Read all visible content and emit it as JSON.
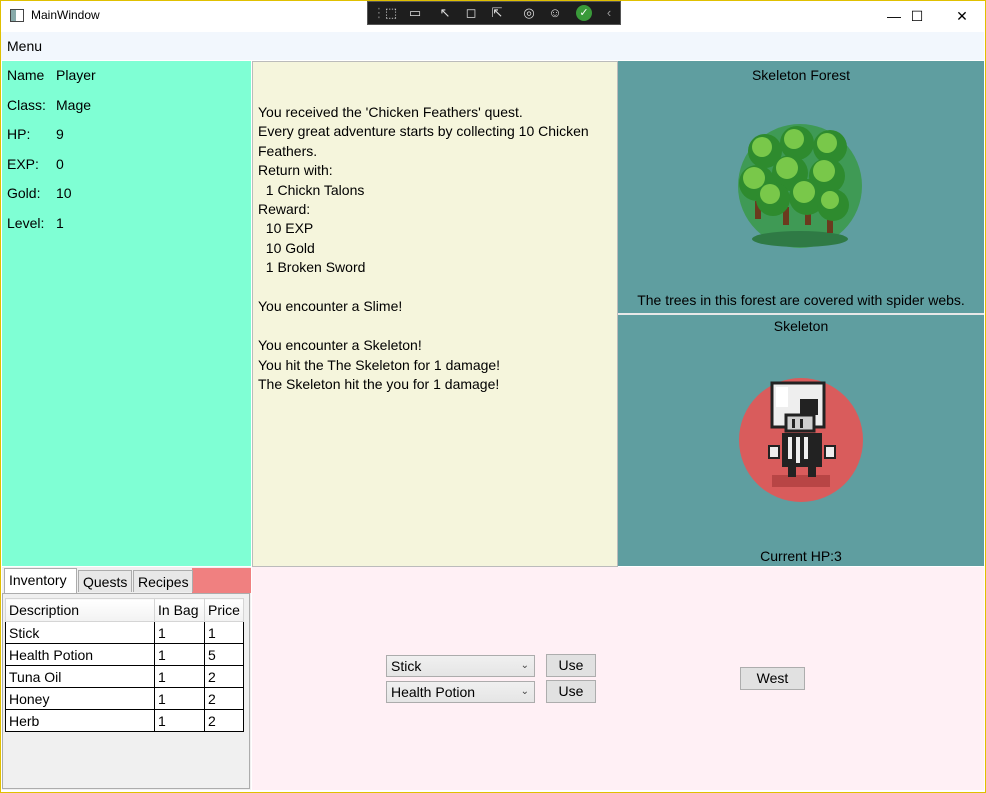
{
  "window": {
    "title": "MainWindow",
    "controls": {
      "minimize": "—",
      "maximize": "☐",
      "close": "✕"
    }
  },
  "devtools": {
    "icons": [
      "select-element-icon",
      "live-preview-icon",
      "cursor-icon",
      "bounds-icon",
      "layout-icon",
      "track-focus-icon",
      "accessibility-icon",
      "binding-ok-icon",
      "collapse-chevron-icon"
    ]
  },
  "menu": {
    "label": "Menu"
  },
  "player": {
    "stats": [
      {
        "label": "Name",
        "value": "Player"
      },
      {
        "label": "Class:",
        "value": "Mage"
      },
      {
        "label": "HP:",
        "value": "9"
      },
      {
        "label": "EXP:",
        "value": "0"
      },
      {
        "label": "Gold:",
        "value": "10"
      },
      {
        "label": "Level:",
        "value": "1"
      }
    ]
  },
  "messages": [
    "You received the 'Chicken Feathers' quest.",
    "Every great adventure starts by collecting 10 Chicken",
    "Feathers.",
    "Return with:",
    "  1 Chickn Talons",
    "Reward:",
    "  10 EXP",
    "  10 Gold",
    "  1 Broken Sword",
    "",
    "You encounter a Slime!",
    "",
    "You encounter a Skeleton!",
    "You hit the The Skeleton for 1 damage!",
    "The Skeleton hit the you for 1 damage!"
  ],
  "location": {
    "name": "Skeleton Forest",
    "description": "The trees in this forest are covered with spider webs."
  },
  "monster": {
    "name": "Skeleton",
    "hp_text": "Current HP:3"
  },
  "tabs": [
    {
      "label": "Inventory",
      "active": true
    },
    {
      "label": "Quests",
      "active": false
    },
    {
      "label": "Recipes",
      "active": false
    }
  ],
  "inventory": {
    "columns": [
      "Description",
      "In Bag",
      "Price"
    ],
    "rows": [
      [
        "Stick",
        "1",
        "1"
      ],
      [
        "Health Potion",
        "1",
        "5"
      ],
      [
        "Tuna Oil",
        "1",
        "2"
      ],
      [
        "Honey",
        "1",
        "2"
      ],
      [
        "Herb",
        "1",
        "2"
      ]
    ]
  },
  "actions": {
    "weapon_select": "Stick",
    "consumable_select": "Health Potion",
    "use_label": "Use",
    "use_label_2": "Use",
    "west_label": "West"
  },
  "colors": {
    "player_bg": "#7fffd4",
    "messages_bg": "#f5f5dc",
    "location_bg": "#5f9ea0",
    "actions_bg": "#fff0f5",
    "tab_strip": "#f08080"
  }
}
